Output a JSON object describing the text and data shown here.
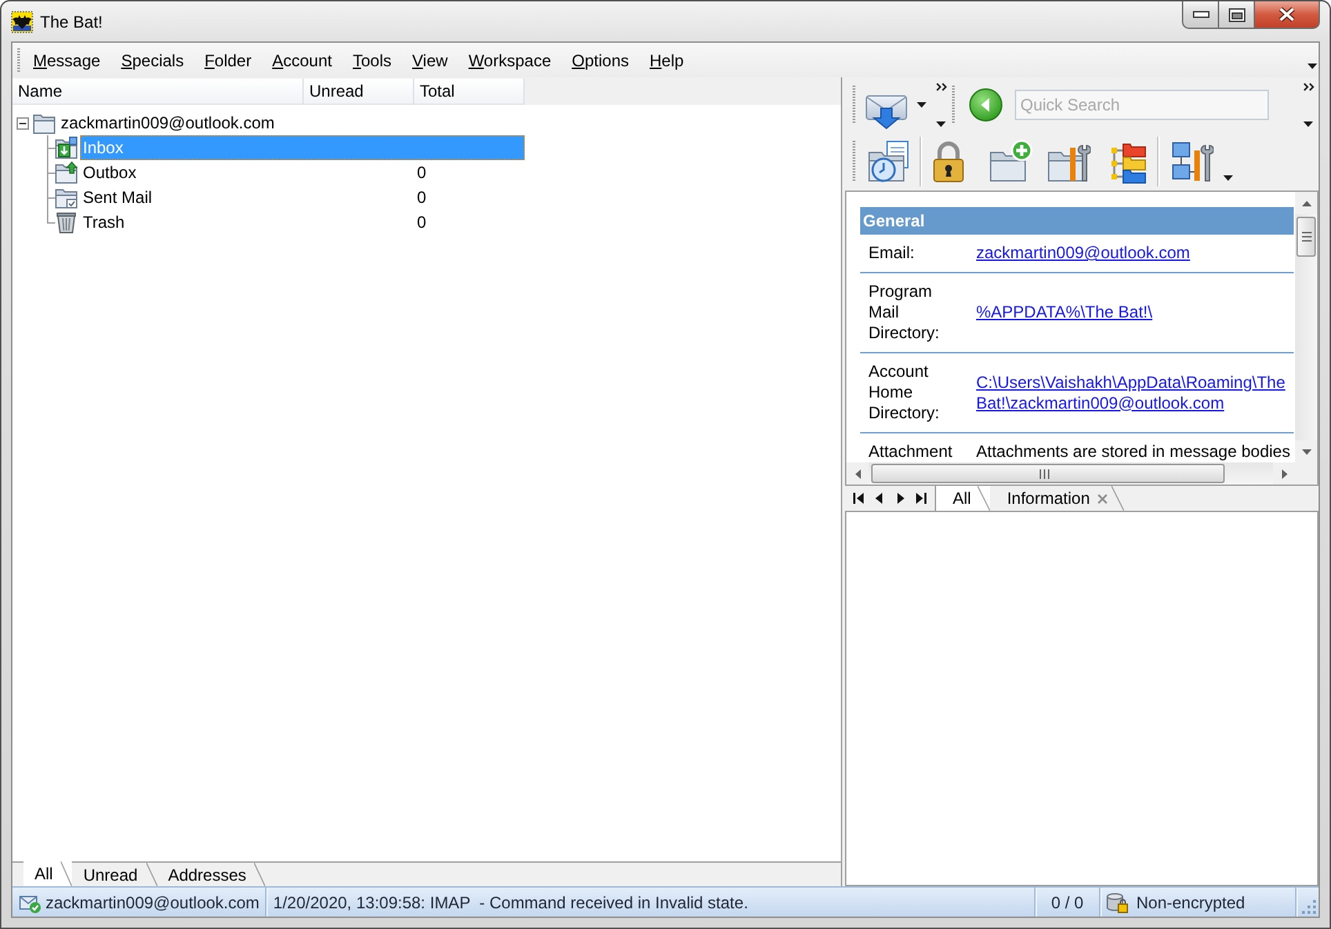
{
  "window": {
    "title": "The Bat!"
  },
  "menu": [
    "Message",
    "Specials",
    "Folder",
    "Account",
    "Tools",
    "View",
    "Workspace",
    "Options",
    "Help"
  ],
  "folder_pane": {
    "columns": [
      "Name",
      "Unread",
      "Total"
    ],
    "account": {
      "name": "zackmartin009@outlook.com",
      "expanded": true,
      "children": [
        {
          "name": "Inbox",
          "kind": "inbox",
          "selected": true
        },
        {
          "name": "Outbox",
          "kind": "outbox",
          "selected": false,
          "total": "0"
        },
        {
          "name": "Sent Mail",
          "kind": "sent",
          "selected": false,
          "total": "0"
        },
        {
          "name": "Trash",
          "kind": "trash",
          "selected": false,
          "total": "0"
        }
      ]
    },
    "tabs": [
      {
        "label": "All",
        "selected": true
      },
      {
        "label": "Unread",
        "selected": false
      },
      {
        "label": "Addresses",
        "selected": false
      }
    ]
  },
  "toolbar": {
    "quick_search": {
      "placeholder": "Quick Search"
    }
  },
  "info_panel": {
    "section": "General",
    "rows": [
      {
        "label": "Email:",
        "value": "zackmartin009@outlook.com",
        "kind": "link"
      },
      {
        "label": "Program Mail Directory:",
        "value": "%APPDATA%\\The Bat!\\",
        "kind": "link"
      },
      {
        "label": "Account Home Directory:",
        "value": "C:\\Users\\Vaishakh\\AppData\\Roaming\\The Bat!\\zackmartin009@outlook.com",
        "kind": "link"
      },
      {
        "label": "Attachment",
        "value": "Attachments are stored in message bodies",
        "kind": "text"
      }
    ]
  },
  "info_tabs": [
    {
      "label": "All",
      "selected": true
    },
    {
      "label": "Information",
      "selected": false,
      "closable": true
    }
  ],
  "status_bar": {
    "account": "zackmartin009@outlook.com",
    "message": "1/20/2020, 13:09:58: IMAP  - Command received in Invalid state.",
    "counter": "0 / 0",
    "encryption": "Non-encrypted"
  }
}
